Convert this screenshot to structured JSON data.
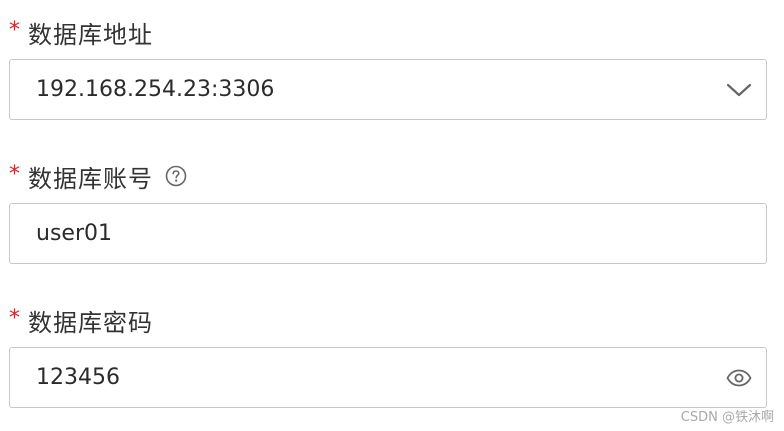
{
  "fields": [
    {
      "required_mark": "*",
      "label": "数据库地址",
      "value": "192.168.254.23:3306",
      "control": "select",
      "trailing_icon": "chevron-down-icon"
    },
    {
      "required_mark": "*",
      "label": "数据库账号",
      "has_help": true,
      "help_icon": "question-circle-icon",
      "value": "user01",
      "control": "text-input"
    },
    {
      "required_mark": "*",
      "label": "数据库密码",
      "value": "123456",
      "control": "password-input",
      "trailing_icon": "eye-icon"
    }
  ],
  "colors": {
    "required": "#e02020",
    "label": "#333333",
    "border": "#c8c8c8",
    "icon": "#666666"
  },
  "watermark": "CSDN @铁沐啊"
}
